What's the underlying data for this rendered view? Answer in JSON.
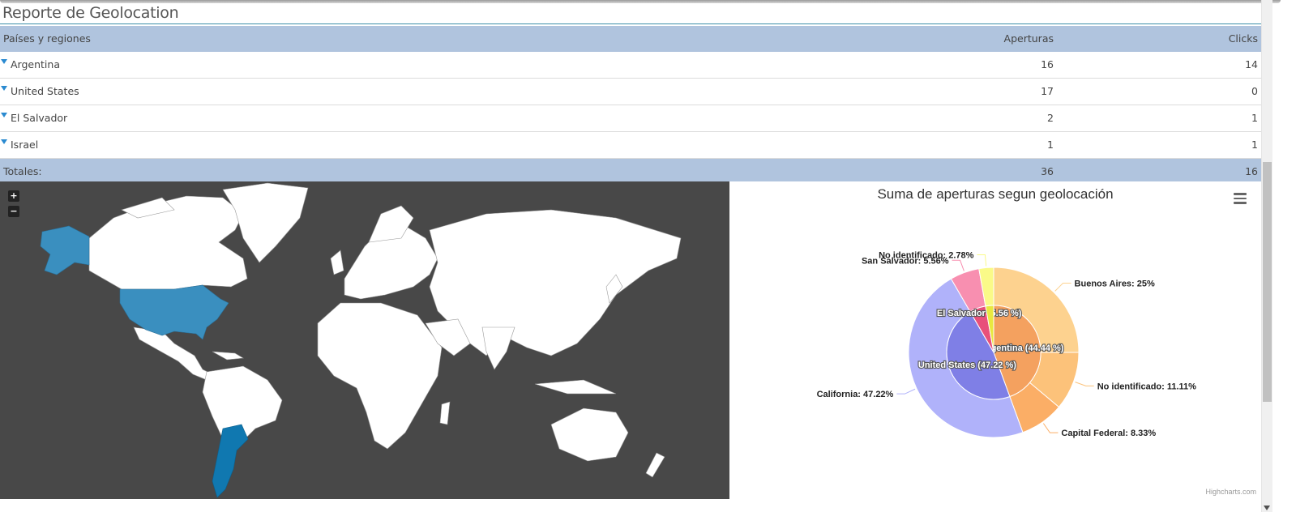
{
  "report": {
    "title": "Reporte de Geolocation"
  },
  "table": {
    "headers": {
      "name": "Países y regiones",
      "opens": "Aperturas",
      "clicks": "Clicks"
    },
    "rows": [
      {
        "name": "Argentina",
        "opens": "16",
        "clicks": "14"
      },
      {
        "name": "United States",
        "opens": "17",
        "clicks": "0"
      },
      {
        "name": "El Salvador",
        "opens": "2",
        "clicks": "1"
      },
      {
        "name": "Israel",
        "opens": "1",
        "clicks": "1"
      }
    ],
    "totals": {
      "label": "Totales:",
      "opens": "36",
      "clicks": "16"
    }
  },
  "map": {
    "zoom_in": "+",
    "zoom_out": "−",
    "ocean_color": "#484848",
    "land_color": "#ffffff",
    "highlight_colors": {
      "United States": "#3a8fbf",
      "Argentina": "#1078b0"
    }
  },
  "chart": {
    "title": "Suma de aperturas segun geolocación",
    "menu_icon": "hamburger-menu-icon",
    "credits": "Highcharts.com"
  },
  "chart_data": {
    "type": "pie",
    "title": "Suma de aperturas segun geolocación",
    "inner": [
      {
        "name": "Argentina",
        "label": "Argentina (44.44 %)",
        "value": 44.44,
        "color": "#f4a15f"
      },
      {
        "name": "United States",
        "label": "United States (47.22 %)",
        "value": 47.22,
        "color": "#7f7fe6"
      },
      {
        "name": "El Salvador",
        "label": "El Salvador (5.56 %)",
        "value": 5.56,
        "color": "#e8507a"
      },
      {
        "name": "Israel",
        "label": "",
        "value": 2.78,
        "color": "#e8e840"
      }
    ],
    "outer": [
      {
        "name": "Buenos Aires",
        "label": "Buenos Aires: 25%",
        "value": 25,
        "color": "#fdd28f",
        "side": "right"
      },
      {
        "name": "No identificado",
        "label": "No identificado: 11.11%",
        "value": 11.11,
        "color": "#fcc27a",
        "side": "right"
      },
      {
        "name": "Capital Federal",
        "label": "Capital Federal: 8.33%",
        "value": 8.33,
        "color": "#fbae66",
        "side": "right"
      },
      {
        "name": "California",
        "label": "California: 47.22%",
        "value": 47.22,
        "color": "#b0b2fa",
        "side": "left"
      },
      {
        "name": "San Salvador",
        "label": "San Salvador: 5.56%",
        "value": 5.56,
        "color": "#f88fb0",
        "side": "left"
      },
      {
        "name": "No identificado",
        "label": "No identificado: 2.78%",
        "value": 2.78,
        "color": "#fafa88",
        "side": "left"
      }
    ]
  }
}
